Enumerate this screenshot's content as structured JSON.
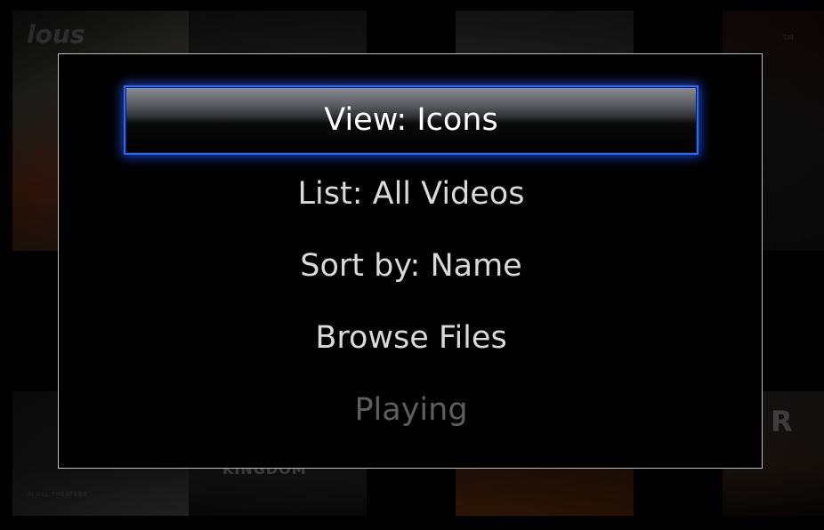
{
  "background": {
    "poster_logo": "lous",
    "poster_tm": "TM",
    "poster_r": "R",
    "poster_faded_title": "KINGDOM",
    "poster_caption": "IN ALL THEATERS"
  },
  "menu": {
    "items": [
      {
        "label": "View: Icons",
        "state": "selected"
      },
      {
        "label": "List: All Videos",
        "state": "normal"
      },
      {
        "label": "Sort by: Name",
        "state": "normal"
      },
      {
        "label": "Browse Files",
        "state": "normal"
      },
      {
        "label": "Playing",
        "state": "disabled"
      }
    ]
  },
  "colors": {
    "selection_border": "#2f66ff",
    "text_normal": "#d9d9d9",
    "text_selected": "#ffffff",
    "text_disabled": "#5e5e5e",
    "dialog_border": "#bdbdbd"
  }
}
